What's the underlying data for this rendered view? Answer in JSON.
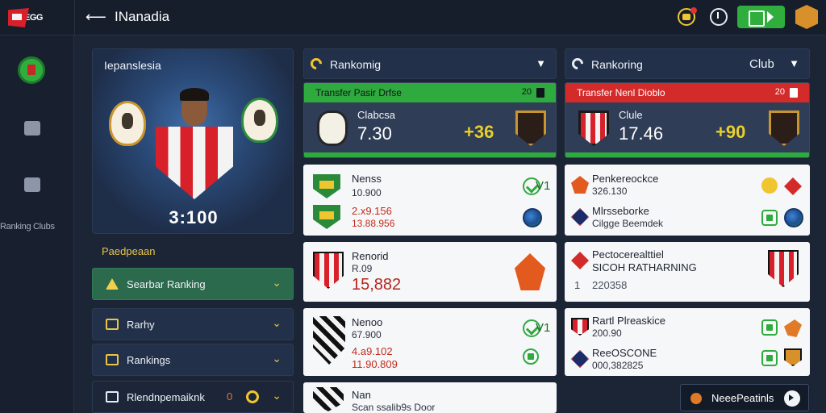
{
  "header": {
    "logo_text": "EGG",
    "back_glyph": "⟵",
    "title": "INanadia"
  },
  "sidebar": {
    "label": "Ranking Clubs"
  },
  "hero": {
    "title": "Iepanslesia",
    "score": "3:100"
  },
  "filters": {
    "label": "Paedpeaan",
    "items": [
      {
        "label": "Searbar Ranking",
        "active": true
      },
      {
        "label": "Rarhy"
      },
      {
        "label": "Rankings"
      },
      {
        "label": "Rlendnpemaiknk",
        "tag": "0"
      }
    ]
  },
  "ranking_left": {
    "title": "Rankomig",
    "transfer_label": "Transfer Pasir Drfse",
    "transfer_num": "20",
    "club_name": "Clabcsa",
    "club_value": "7.30",
    "gold_value": "+36"
  },
  "ranking_right": {
    "title": "Rankoring",
    "club_label": "Club",
    "transfer_label": "Transfer Nenl Dioblo",
    "transfer_num": "20",
    "club_name": "Clule",
    "club_value": "17.46",
    "gold_value": "+90"
  },
  "cards_left": [
    {
      "name": "Nenss",
      "sub": "10.900",
      "red": "2.x9.156",
      "red2": "13.88.956",
      "badge_num": "V1"
    },
    {
      "name": "Renorid",
      "sub": "R.09",
      "big": "15,882"
    },
    {
      "name": "Nenoo",
      "sub": "67.900",
      "red": "4.a9.102",
      "red2": "11.90.809",
      "badge_num": "V1"
    },
    {
      "name": "Nan",
      "sub": "Scan ssalib9s Door"
    }
  ],
  "cards_right": [
    {
      "name": "Penkereockce",
      "sub": "326.130",
      "name2": "Mlrsseborke",
      "sub2": "Cilgge Beemdek"
    },
    {
      "name": "Pectocerealttiel",
      "sub": "SICOH RATHARNING",
      "lead": "1",
      "gray": "220358"
    },
    {
      "name": "Rartl Plreaskice",
      "sub": "200.90",
      "name2": "ReeOSCONE",
      "sub2": "000,382825"
    }
  ],
  "bottom_button": {
    "label": "NeeePeatinls"
  },
  "colors": {
    "bg": "#1c2536",
    "panel": "#223049",
    "accent_green": "#2faa3e",
    "accent_red": "#d32a2a",
    "gold": "#e9cf2e"
  }
}
